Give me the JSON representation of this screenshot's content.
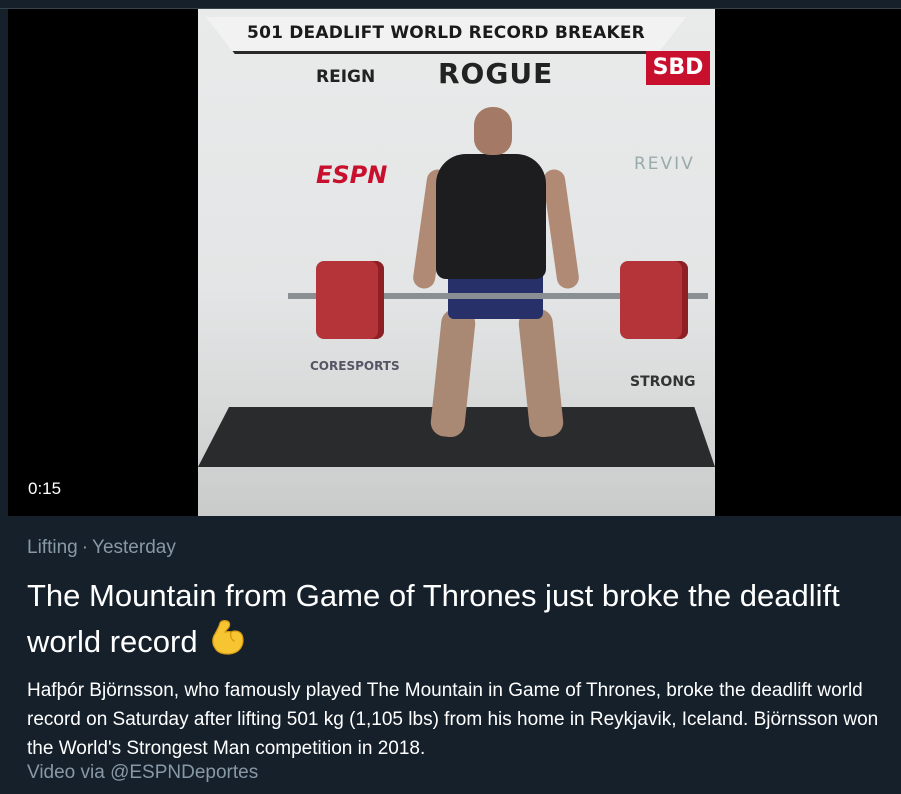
{
  "media": {
    "banner_text": "501 DEADLIFT WORLD RECORD BREAKER",
    "duration": "0:15",
    "sponsors": {
      "reign": "REIGN",
      "rogue": "ROGUE",
      "espn": "ESPN",
      "revive": "REVIV",
      "coresports": "CORESPORTS",
      "strong": "STRONG",
      "sbd": "SBD"
    }
  },
  "story": {
    "category": "Lifting",
    "separator": "·",
    "time": "Yesterday",
    "headline": "The Mountain from Game of Thrones just broke the deadlift world record",
    "headline_emoji": "flexed-biceps-icon",
    "description": "Hafþór Björnsson, who famously played The Mountain in Game of Thrones, broke the deadlift world record on Saturday after lifting 501 kg (1,105 lbs) from his home in Reykjavik, Iceland. Björnsson won the World's Strongest Man competition in 2018.",
    "credit": "Video via @ESPNDeportes"
  },
  "colors": {
    "background": "#15202b",
    "secondary_text": "#8899a6",
    "primary_text": "#ffffff",
    "emoji": "#f7c531"
  }
}
